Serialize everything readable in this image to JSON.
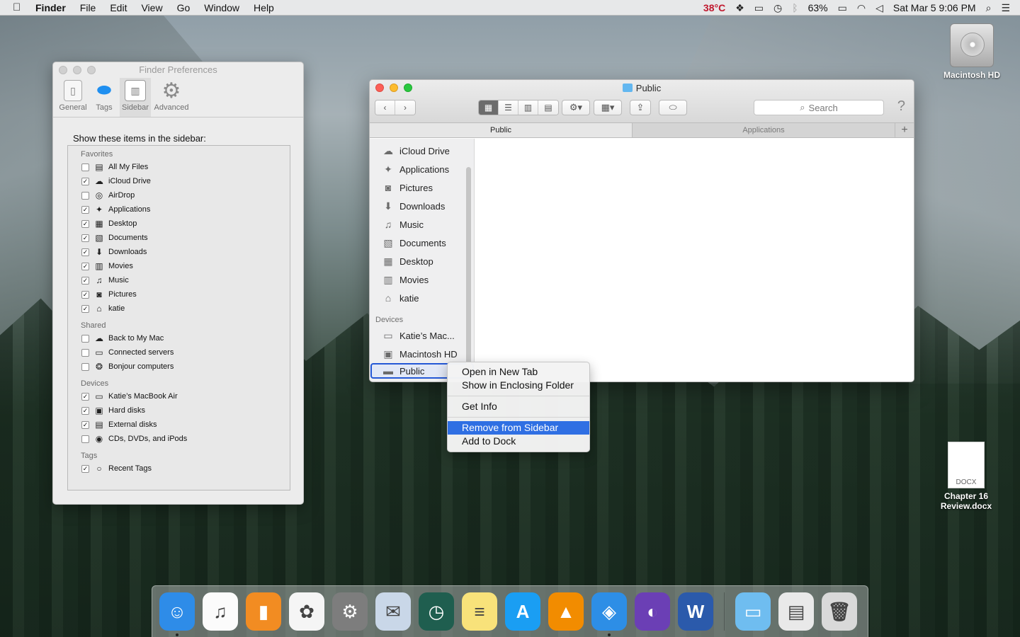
{
  "menubar": {
    "apple_icon": "apple-icon",
    "app": "Finder",
    "menus": [
      "File",
      "Edit",
      "View",
      "Go",
      "Window",
      "Help"
    ],
    "temperature": "38°C",
    "battery": "63%",
    "clock": "Sat Mar 5  9:06 PM"
  },
  "desktop": {
    "hd_label": "Macintosh HD",
    "docx_badge": "DOCX",
    "docx_label_1": "Chapter 16",
    "docx_label_2": "Review.docx"
  },
  "prefs": {
    "title": "Finder Preferences",
    "tabs": [
      "General",
      "Tags",
      "Sidebar",
      "Advanced"
    ],
    "heading": "Show these items in the sidebar:",
    "sections": {
      "favorites": "Favorites",
      "shared": "Shared",
      "devices": "Devices",
      "tags": "Tags"
    },
    "favorites": [
      {
        "label": "All My Files",
        "checked": false,
        "icon": "all-files-icon",
        "glyph": "▤"
      },
      {
        "label": "iCloud Drive",
        "checked": true,
        "icon": "cloud-icon",
        "glyph": "☁"
      },
      {
        "label": "AirDrop",
        "checked": false,
        "icon": "airdrop-icon",
        "glyph": "◎"
      },
      {
        "label": "Applications",
        "checked": true,
        "icon": "applications-icon",
        "glyph": "✦"
      },
      {
        "label": "Desktop",
        "checked": true,
        "icon": "desktop-icon",
        "glyph": "▦"
      },
      {
        "label": "Documents",
        "checked": true,
        "icon": "documents-icon",
        "glyph": "▧"
      },
      {
        "label": "Downloads",
        "checked": true,
        "icon": "downloads-icon",
        "glyph": "⬇"
      },
      {
        "label": "Movies",
        "checked": true,
        "icon": "movies-icon",
        "glyph": "▥"
      },
      {
        "label": "Music",
        "checked": true,
        "icon": "music-icon",
        "glyph": "♫"
      },
      {
        "label": "Pictures",
        "checked": true,
        "icon": "pictures-icon",
        "glyph": "◙"
      },
      {
        "label": "katie",
        "checked": true,
        "icon": "home-icon",
        "glyph": "⌂"
      }
    ],
    "shared": [
      {
        "label": "Back to My Mac",
        "checked": false,
        "icon": "cloud-icon",
        "glyph": "☁"
      },
      {
        "label": "Connected servers",
        "checked": false,
        "icon": "server-icon",
        "glyph": "▭"
      },
      {
        "label": "Bonjour computers",
        "checked": false,
        "icon": "bonjour-icon",
        "glyph": "❂"
      }
    ],
    "devices": [
      {
        "label": "Katie’s MacBook Air",
        "checked": true,
        "icon": "laptop-icon",
        "glyph": "▭"
      },
      {
        "label": "Hard disks",
        "checked": true,
        "icon": "hard-disk-icon",
        "glyph": "▣"
      },
      {
        "label": "External disks",
        "checked": true,
        "icon": "external-disk-icon",
        "glyph": "▤"
      },
      {
        "label": "CDs, DVDs, and iPods",
        "checked": false,
        "icon": "cd-icon",
        "glyph": "◉"
      }
    ],
    "tags": [
      {
        "label": "Recent Tags",
        "checked": true,
        "icon": "tag-circle-icon",
        "glyph": "○"
      }
    ]
  },
  "finder": {
    "title": "Public",
    "search_placeholder": "Search",
    "tabs": [
      "Public",
      "Applications"
    ],
    "favorites": [
      {
        "label": "iCloud Drive",
        "icon": "cloud-icon",
        "glyph": "☁"
      },
      {
        "label": "Applications",
        "icon": "applications-icon",
        "glyph": "✦"
      },
      {
        "label": "Pictures",
        "icon": "pictures-icon",
        "glyph": "◙"
      },
      {
        "label": "Downloads",
        "icon": "downloads-icon",
        "glyph": "⬇"
      },
      {
        "label": "Music",
        "icon": "music-icon",
        "glyph": "♫"
      },
      {
        "label": "Documents",
        "icon": "documents-icon",
        "glyph": "▧"
      },
      {
        "label": "Desktop",
        "icon": "desktop-icon",
        "glyph": "▦"
      },
      {
        "label": "Movies",
        "icon": "movies-icon",
        "glyph": "▥"
      },
      {
        "label": "katie",
        "icon": "home-icon",
        "glyph": "⌂"
      }
    ],
    "devices_header": "Devices",
    "devices": [
      {
        "label": "Katie’s Mac...",
        "icon": "laptop-icon",
        "glyph": "▭"
      },
      {
        "label": "Macintosh HD",
        "icon": "hard-disk-icon",
        "glyph": "▣"
      }
    ],
    "selected": {
      "label": "Public",
      "icon": "folder-icon",
      "glyph": "▬"
    }
  },
  "context_menu": {
    "items": [
      "Open in New Tab",
      "Show in Enclosing Folder",
      "Get Info",
      "Remove from Sidebar",
      "Add to Dock"
    ]
  },
  "dock": [
    {
      "name": "finder",
      "bg": "#2e8ce8",
      "glyph": "☺"
    },
    {
      "name": "itunes",
      "bg": "#fbfbfb",
      "glyph": "♫"
    },
    {
      "name": "ibooks",
      "bg": "#f28c22",
      "glyph": "▮"
    },
    {
      "name": "photos",
      "bg": "#f5f5f5",
      "glyph": "✿"
    },
    {
      "name": "system-preferences",
      "bg": "#7d7d7d",
      "glyph": "⚙"
    },
    {
      "name": "mail",
      "bg": "#c9d7e8",
      "glyph": "✉"
    },
    {
      "name": "time-machine",
      "bg": "#1f5e4f",
      "glyph": "◷"
    },
    {
      "name": "notes",
      "bg": "#f8e27a",
      "glyph": "≡"
    },
    {
      "name": "app-store",
      "bg": "#1a9ef3",
      "glyph": "A"
    },
    {
      "name": "vlc",
      "bg": "#f28c00",
      "glyph": "▲"
    },
    {
      "name": "safari",
      "bg": "#2d8ee6",
      "glyph": "◈"
    },
    {
      "name": "bittorrent",
      "bg": "#6b3fb5",
      "glyph": "◐"
    },
    {
      "name": "word",
      "bg": "#2b5aab",
      "glyph": "W"
    },
    {
      "name": "downloads-folder",
      "bg": "#6fbdf0",
      "glyph": "▭"
    },
    {
      "name": "document-stack",
      "bg": "#e9e9e9",
      "glyph": "▤"
    },
    {
      "name": "trash",
      "bg": "#d9d9d9",
      "glyph": "🗑"
    }
  ]
}
